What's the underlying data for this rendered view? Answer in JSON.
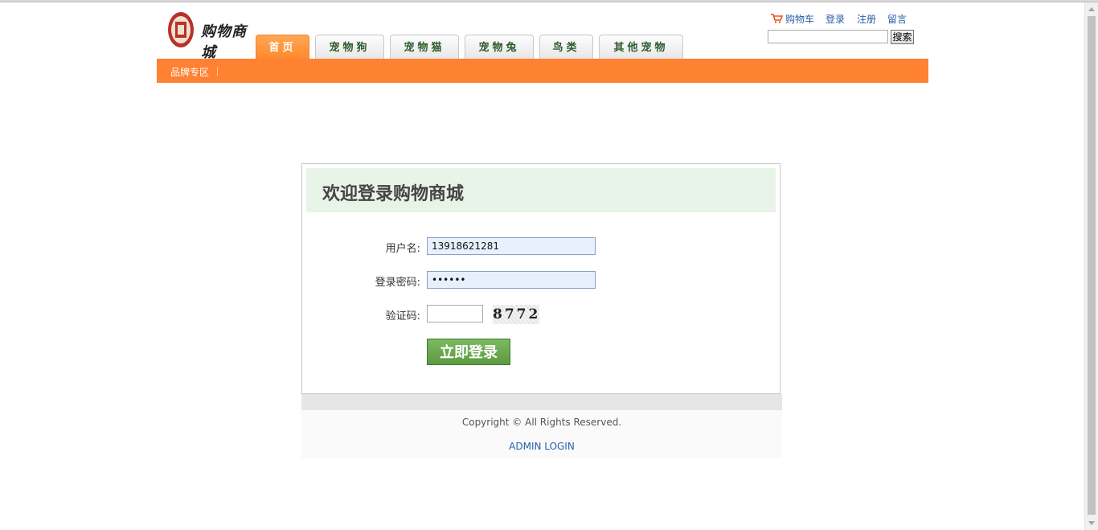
{
  "brand": {
    "name": "购物商城"
  },
  "nav": {
    "tabs": [
      {
        "label": "首页",
        "active": true
      },
      {
        "label": "宠物狗",
        "active": false
      },
      {
        "label": "宠物猫",
        "active": false
      },
      {
        "label": "宠物兔",
        "active": false
      },
      {
        "label": "鸟类",
        "active": false
      },
      {
        "label": "其他宠物",
        "active": false
      }
    ],
    "subnav": {
      "label": "品牌专区"
    }
  },
  "toplinks": {
    "cart": "购物车",
    "login": "登录",
    "register": "注册",
    "message": "留言"
  },
  "search": {
    "value": "",
    "button": "搜索"
  },
  "login": {
    "title": "欢迎登录购物商城",
    "username_label": "用户名:",
    "username_value": "13918621281",
    "password_label": "登录密码:",
    "password_value": "••••••",
    "captcha_label": "验证码:",
    "captcha_value": "",
    "captcha_text": "8772",
    "submit": "立即登录"
  },
  "footer": {
    "copyright": "Copyright © All Rights Reserved.",
    "admin_login": "ADMIN LOGIN"
  },
  "colors": {
    "accent": "#ff8132",
    "tab_text": "#2d5a2d",
    "login_head_bg": "#e9f4e9",
    "button_green": "#68a54d",
    "link": "#2a5fa8"
  },
  "icons": {
    "cart": "shopping-cart-icon",
    "logo": "seal-logo-icon"
  }
}
